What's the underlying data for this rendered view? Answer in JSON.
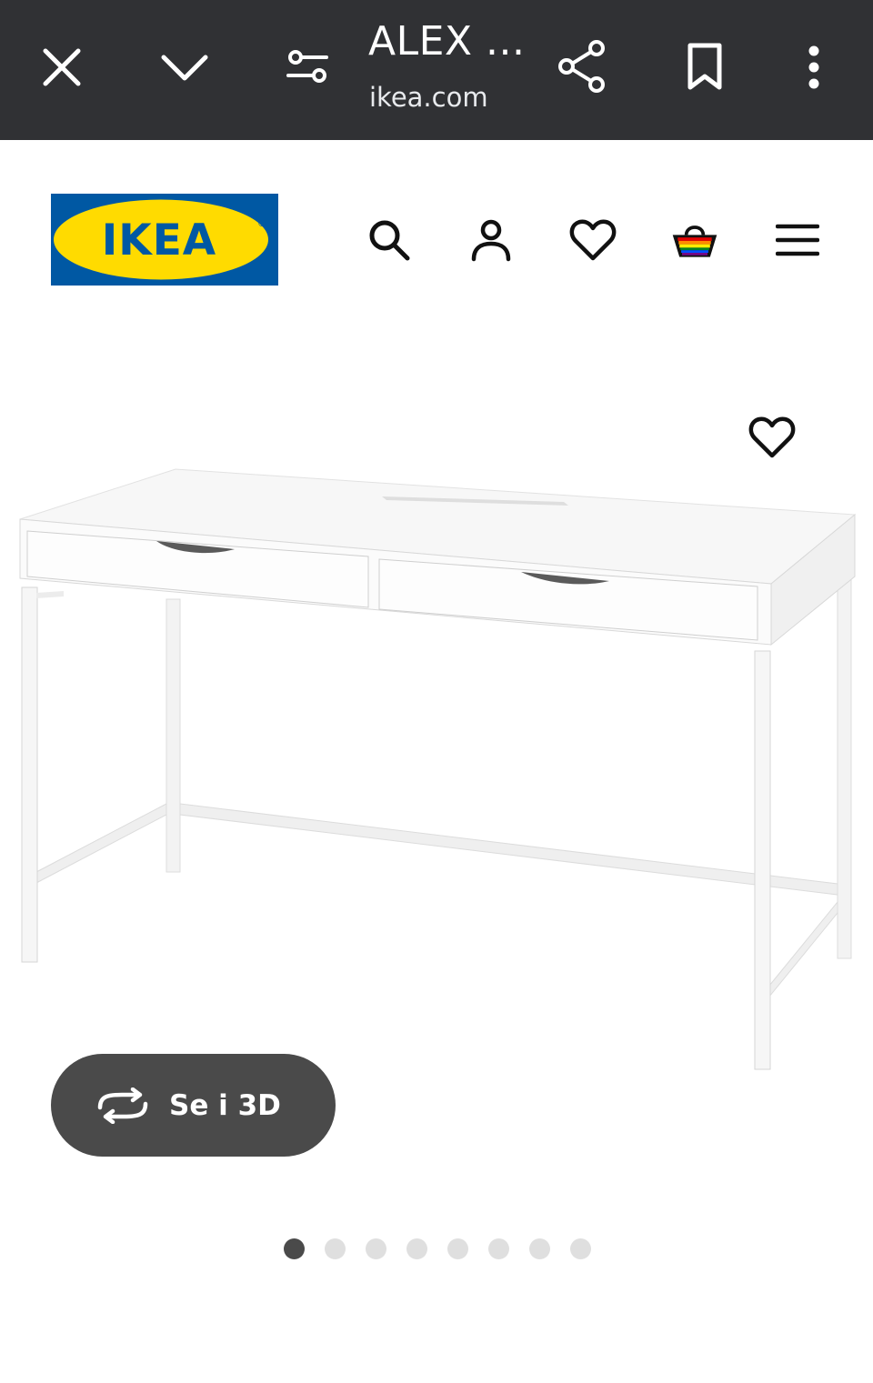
{
  "browser": {
    "title": "ALEX ...",
    "url": "ikea.com",
    "icons": [
      "close-icon",
      "chevron-down-icon",
      "tune-icon",
      "share-icon",
      "bookmark-icon",
      "more-vert-icon"
    ]
  },
  "header": {
    "logo_text": "IKEA",
    "nav_icons": [
      "search-icon",
      "account-icon",
      "heart-icon",
      "basket-icon",
      "menu-icon"
    ]
  },
  "product": {
    "view3d_label": "Se i 3D",
    "gallery": {
      "total_images": 8,
      "active_index": 0
    }
  },
  "colors": {
    "topbar_bg": "#303134",
    "ikea_blue": "#0058a3",
    "ikea_yellow": "#ffdb00",
    "button_dark": "#4a4a4a"
  }
}
